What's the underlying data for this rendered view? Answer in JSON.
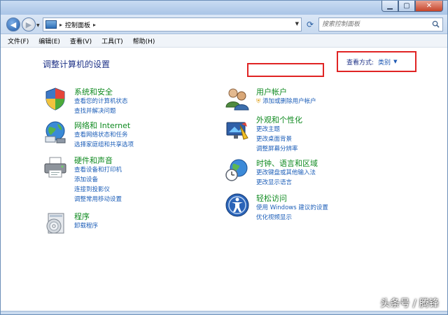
{
  "window": {
    "buttons": {
      "minimize": "▁",
      "maximize": "▢",
      "close": "✕"
    }
  },
  "address": {
    "breadcrumb": "控制面板",
    "search_placeholder": "搜索控制面板"
  },
  "menu": [
    "文件(F)",
    "编辑(E)",
    "查看(V)",
    "工具(T)",
    "帮助(H)"
  ],
  "main": {
    "title": "调整计算机的设置",
    "view_by_label": "查看方式:",
    "view_by_value": "类别"
  },
  "categories": {
    "system": {
      "title": "系统和安全",
      "links": [
        "查看您的计算机状态",
        "查找并解决问题"
      ]
    },
    "network": {
      "title": "网络和 Internet",
      "links": [
        "查看网络状态和任务",
        "选择家庭组和共享选项"
      ]
    },
    "hardware": {
      "title": "硬件和声音",
      "links": [
        "查看设备和打印机",
        "添加设备",
        "连接到投影仪",
        "调整常用移动设置"
      ]
    },
    "programs": {
      "title": "程序",
      "links": [
        "卸载程序"
      ]
    },
    "users": {
      "title": "用户帐户",
      "links": [
        "添加或删除用户帐户"
      ]
    },
    "appearance": {
      "title": "外观和个性化",
      "links": [
        "更改主题",
        "更改桌面背景",
        "调整屏幕分辨率"
      ]
    },
    "clock": {
      "title": "时钟、语言和区域",
      "links": [
        "更改键盘或其他输入法",
        "更改显示语言"
      ]
    },
    "ease": {
      "title": "轻松访问",
      "links": [
        "使用 Windows 建议的设置",
        "优化视频显示"
      ]
    }
  },
  "watermark": "头条号 / 腾锋",
  "colors": {
    "accent": "#1c5eb8",
    "category_title": "#0f8a20",
    "highlight": "#e02424"
  }
}
